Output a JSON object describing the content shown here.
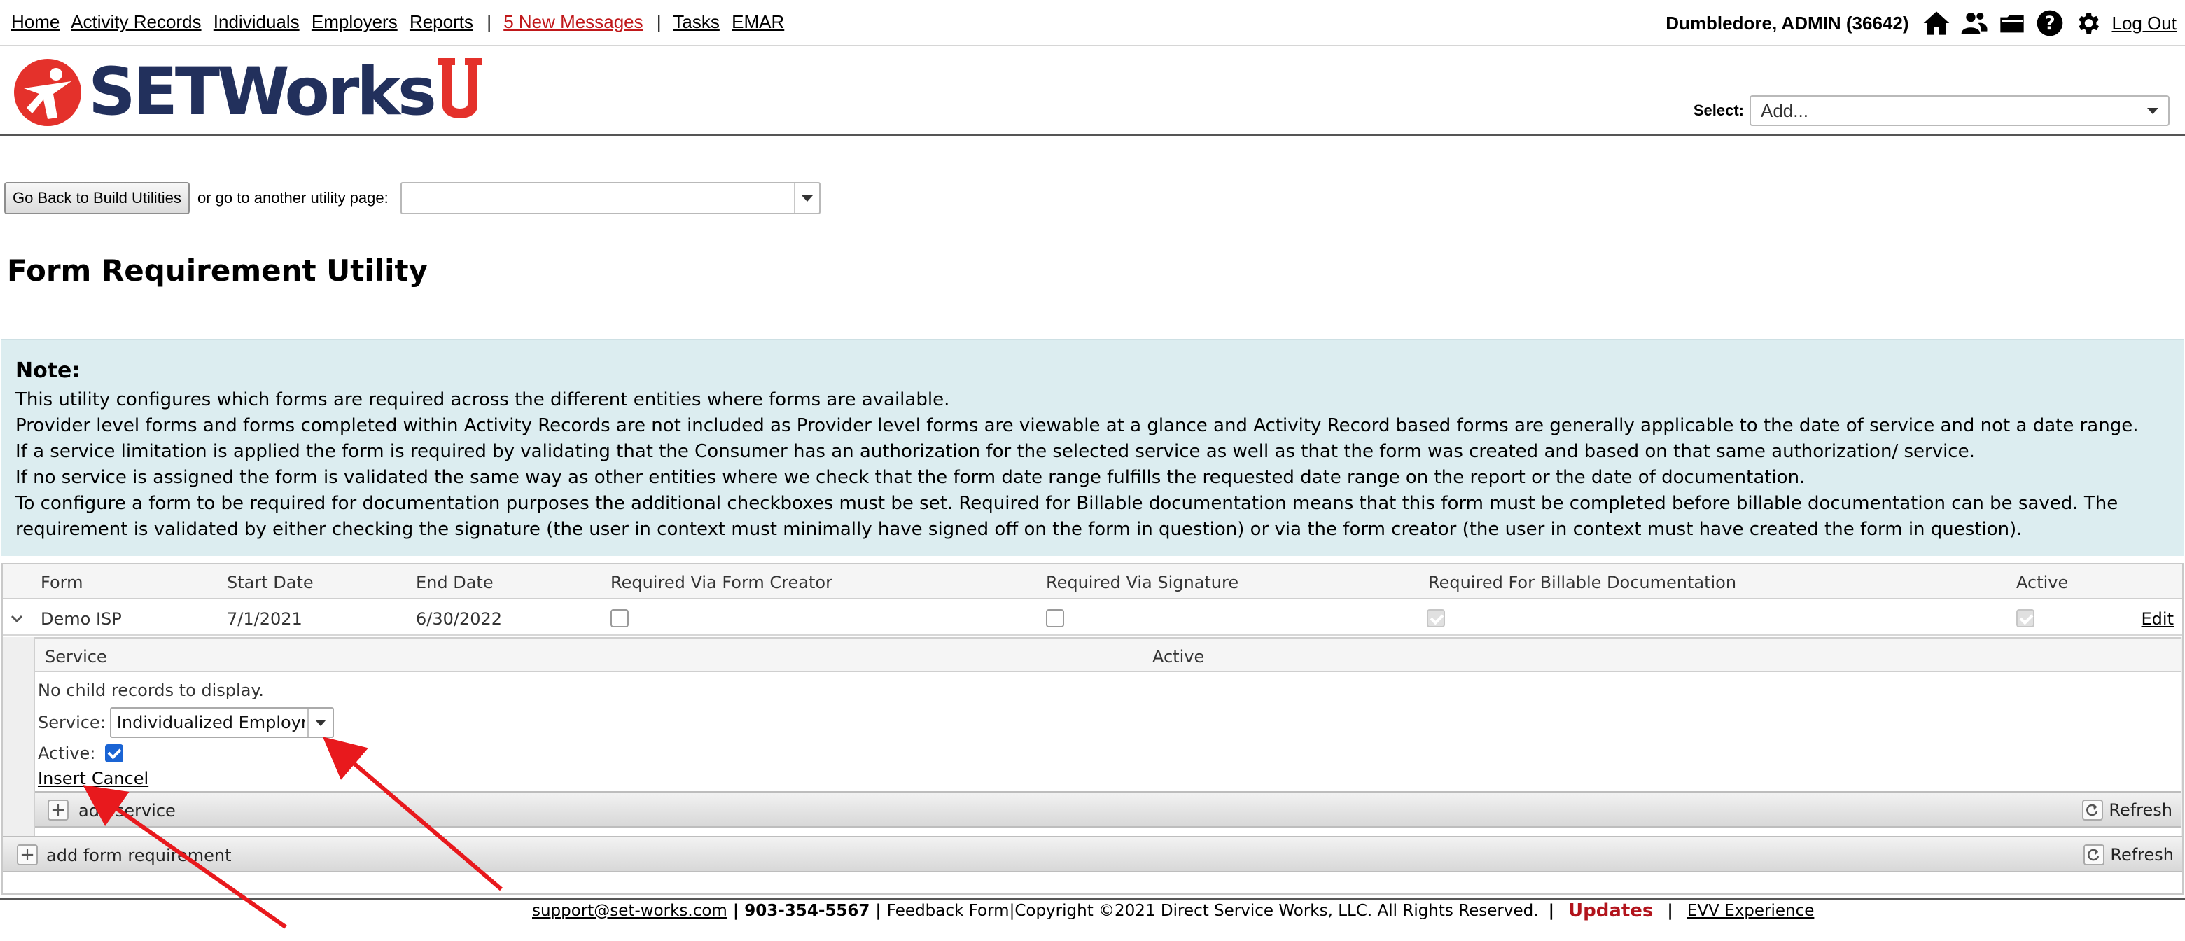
{
  "nav": {
    "links": [
      "Home",
      "Activity Records",
      "Individuals",
      "Employers",
      "Reports"
    ],
    "separator": "|",
    "messages": "5 New Messages",
    "links2": [
      "Tasks",
      "EMAR"
    ],
    "user": "Dumbledore, ADMIN  (36642)",
    "logout": "Log Out",
    "icons": [
      "home-icon",
      "users-icon",
      "folder-icon",
      "help-icon",
      "gear-icon"
    ]
  },
  "logo": {
    "text": "SETWorks",
    "brand_color": "#22305c",
    "accent_color": "#e4312b"
  },
  "select": {
    "label": "Select:",
    "value": "Add..."
  },
  "utility": {
    "back_button": "Go Back to Build Utilities",
    "or_text": "or go to another utility page:"
  },
  "page_title": "Form Requirement Utility",
  "note": {
    "heading": "Note:",
    "lines": [
      "This utility configures which forms are required across the different entities where forms are available.",
      "Provider level forms and forms completed within Activity Records are not included as Provider level forms are viewable at a glance and Activity Record based forms are generally applicable to the date of service and not a date range.",
      "If a service limitation is applied the form is required by validating that the Consumer has an authorization for the selected service as well as that the form was created and based on that same authorization/ service.",
      "If no service is assigned the form is validated the same way as other entities where we check that the form date range fulfills the requested date range on the report or the date of documentation.",
      "To configure a form to be required for documentation purposes the additional checkboxes must be set. Required for Billable documentation means that this form must be completed before billable documentation can be saved. The requirement is validated by either checking the signature (the user in context must minimally have signed off on the form in question) or via the form creator (the user in context must have created the form in question)."
    ]
  },
  "grid": {
    "columns": [
      "Form",
      "Start Date",
      "End Date",
      "Required Via Form Creator",
      "Required Via Signature",
      "Required For Billable Documentation",
      "Active"
    ],
    "rows": [
      {
        "form": "Demo ISP",
        "start": "7/1/2021",
        "end": "6/30/2022",
        "via_creator": false,
        "via_signature": false,
        "billable": true,
        "active": true,
        "edit": "Edit"
      }
    ],
    "child": {
      "columns": [
        "Service",
        "Active"
      ],
      "empty": "No child records to display.",
      "service_label": "Service:",
      "service_value": "Individualized Employment",
      "active_label": "Active:",
      "active_checked": true,
      "insert": "Insert",
      "cancel": "Cancel",
      "add_label": "add service",
      "refresh": "Refresh"
    },
    "add_label": "add form requirement",
    "refresh": "Refresh"
  },
  "footer": {
    "email": "support@set-works.com",
    "phone": "903-354-5567",
    "feedback": "Feedback Form",
    "copyright": "Copyright ©2021 Direct Service Works, LLC. All Rights Reserved.",
    "updates": "Updates",
    "evv": "EVV Experience"
  },
  "annotation_color": "#e8191d"
}
